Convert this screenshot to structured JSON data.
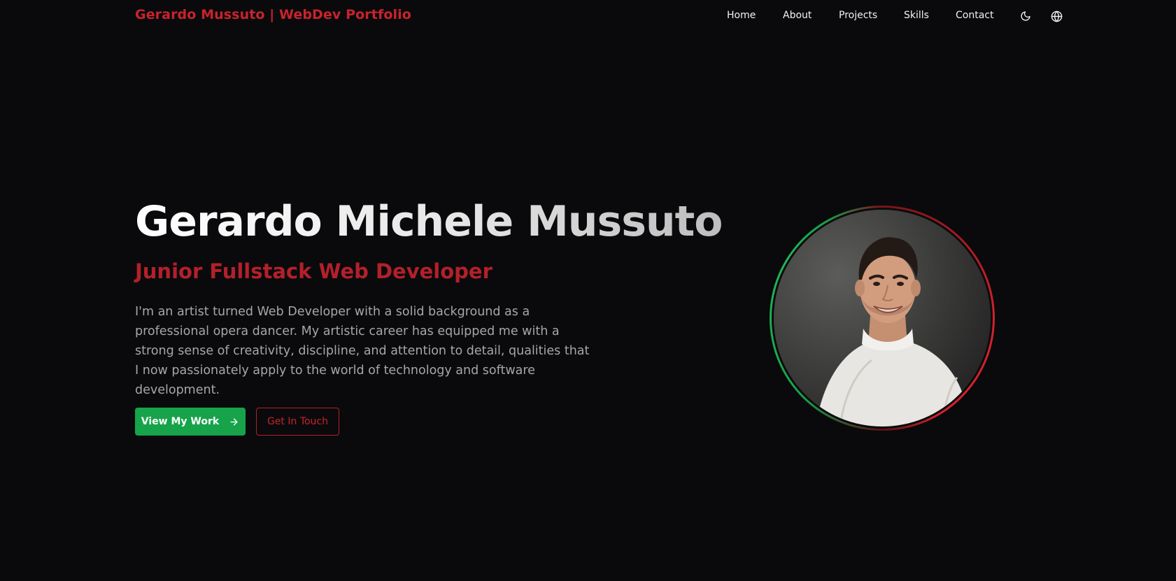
{
  "header": {
    "brand": "Gerardo Mussuto | WebDev Portfolio",
    "nav": {
      "home": "Home",
      "about": "About",
      "projects": "Projects",
      "skills": "Skills",
      "contact": "Contact"
    },
    "theme_icon": "moon-icon",
    "language_icon": "globe-icon"
  },
  "hero": {
    "name": "Gerardo Michele Mussuto",
    "role": "Junior Fullstack Web Developer",
    "bio": "I'm an artist turned Web Developer with a solid background as a professional opera dancer. My artistic career has equipped me with a strong sense of creativity, discipline, and attention to detail, qualities that I now passionately apply to the world of technology and software development.",
    "primary_button": "View My Work",
    "primary_button_icon": "arrow-right-icon",
    "secondary_button": "Get In Touch"
  },
  "colors": {
    "background": "#0a0a0c",
    "brand_red": "#c8232c",
    "accent_green": "#16a34a",
    "body_text": "#a6a6ab"
  }
}
